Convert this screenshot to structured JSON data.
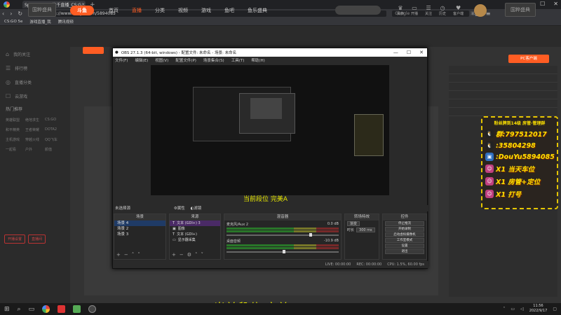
{
  "browser": {
    "tab_title": "SpecialAgent修千直播_CS:G",
    "tab_close": "✕",
    "tab_add": "+",
    "url": "https://www.douyu.com/5894085",
    "search_placeholder": "Google",
    "bookmarks": [
      "CS:GO 5e",
      "游戏直播_我",
      "腾讯视频"
    ],
    "window_controls": [
      "—",
      "☐",
      "✕"
    ]
  },
  "site": {
    "brand_text": "国粹盛典",
    "logo_text": "斗鱼",
    "nav": [
      "首页",
      "直播",
      "分类",
      "视频",
      "游戏",
      "鱼吧",
      "鱼乐盛典"
    ],
    "nav_active_index": 1,
    "header_icons": [
      {
        "icon": "♛",
        "label": "贵族"
      },
      {
        "icon": "▭",
        "label": "开播"
      },
      {
        "icon": "☰",
        "label": "关注"
      },
      {
        "icon": "◷",
        "label": "历史"
      },
      {
        "icon": "♥",
        "label": "客户端"
      },
      {
        "icon": "✉",
        "label": "消息中心"
      }
    ],
    "promo_btn": "PC客户端"
  },
  "sidebar": {
    "items": [
      {
        "icon": "⌂",
        "label": "我的关注"
      },
      {
        "icon": "☰",
        "label": "排行榜"
      },
      {
        "icon": "◎",
        "label": "直播分类"
      },
      {
        "icon": "☐",
        "label": "云游戏"
      }
    ],
    "grid": [
      "英雄联盟",
      "绝地求生",
      "CS:GO",
      "和平精英",
      "王者荣耀",
      "DOTA2",
      "主机游戏",
      "穿越火线",
      "QQ飞车",
      "一起看",
      "户外",
      "颜值"
    ],
    "section_label": "热门推荐",
    "buttons": [
      "开播设置",
      "直播间"
    ]
  },
  "obs": {
    "title": "OBS 27.1.3 (64-bit, windows) - 配置文件: 未命名 - 场景: 未命名",
    "menu": [
      "文件(F)",
      "编辑(E)",
      "视图(V)",
      "配置文件(P)",
      "场景集合(S)",
      "工具(T)",
      "帮助(H)"
    ],
    "preview_caption": "当前段位 完美A",
    "not_selected_label": "未选择源",
    "props_btn": "属性",
    "filters_btn": "滤镜",
    "docks": {
      "scenes": "场景",
      "sources": "来源",
      "mixer": "混音器",
      "transitions": "转场特效",
      "controls": "控件"
    },
    "scenes": [
      "场景 4",
      "场景 2",
      "场景 3"
    ],
    "sources": [
      {
        "icon": "T",
        "label": "文本 (GDI+) 3"
      },
      {
        "icon": "▣",
        "label": "图像"
      },
      {
        "icon": "T",
        "label": "文本 (GDI+)"
      },
      {
        "icon": "▭",
        "label": "显示器采集"
      }
    ],
    "mixer": [
      {
        "name": "麦克风/Aux 2",
        "db": "0.0 dB"
      },
      {
        "name": "桌面音频",
        "db": "-10.9 dB"
      }
    ],
    "transition": {
      "type": "渐变",
      "duration_label": "时长",
      "duration": "300 ms"
    },
    "controls": [
      "停止推流",
      "开始录制",
      "启动虚拟摄像机",
      "工作室模式",
      "设置",
      "退出"
    ],
    "status": {
      "live": "LIVE: 00:00:00",
      "rec": "REC: 00:00:00",
      "cpu": "CPU: 1.5%, 60.00 fps"
    }
  },
  "promo": {
    "title": "粉丝牌到14级 房管·管理群",
    "rows": [
      {
        "icon": "🐧",
        "color": "#222",
        "text": "群:797512017"
      },
      {
        "icon": "🐧",
        "color": "#222",
        "text": ":35804298"
      },
      {
        "icon": "▣",
        "color": "#3070c0",
        "text": ":DouYu5894085"
      },
      {
        "icon": "☺",
        "color": "#c04080",
        "text": "X1 当天车位"
      },
      {
        "icon": "☺",
        "color": "#c04080",
        "text": "X1 房管+定位"
      },
      {
        "icon": "☺",
        "color": "#c04080",
        "text": "X1 打号"
      }
    ]
  },
  "stream_caption": "当前段位 完美A",
  "taskbar": {
    "clock_time": "11:56",
    "clock_date": "2022/9/17"
  }
}
